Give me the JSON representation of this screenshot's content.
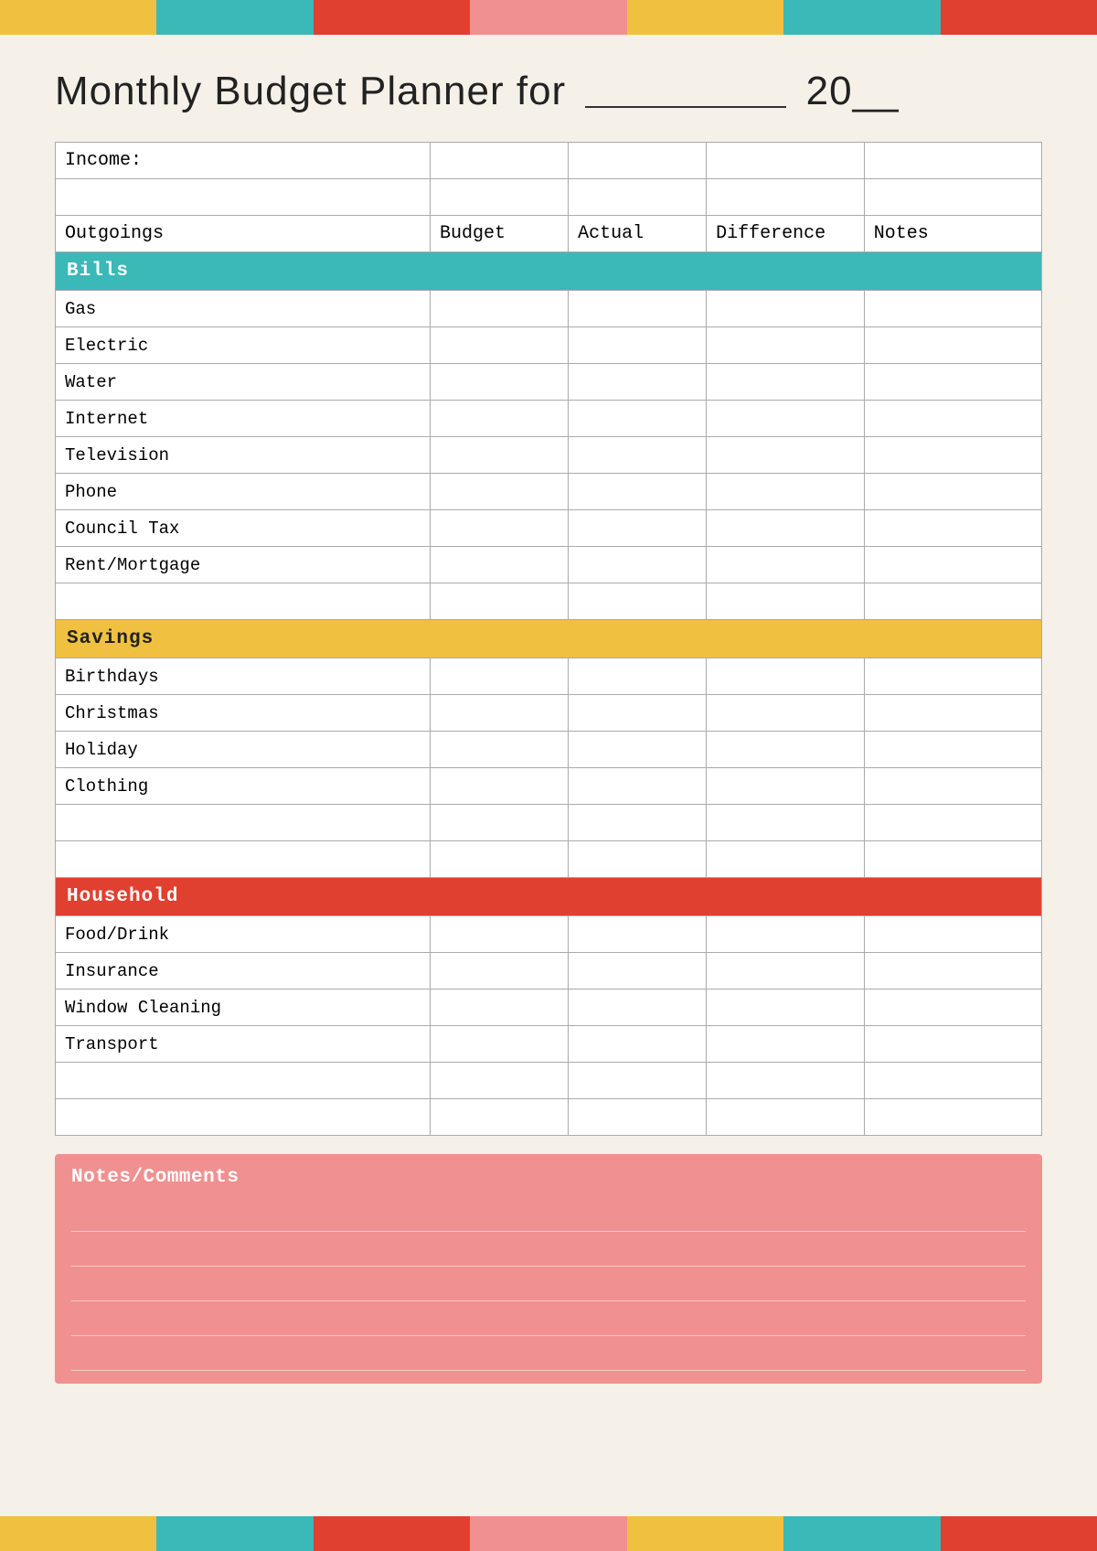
{
  "topBar": {
    "segments": [
      "yellow",
      "teal",
      "red",
      "pink",
      "yellow",
      "teal",
      "red"
    ]
  },
  "title": {
    "part1": "Monthly Budget Planner for",
    "part2": "20"
  },
  "table": {
    "incomeLabel": "Income:",
    "headers": {
      "outgoings": "Outgoings",
      "budget": "Budget",
      "actual": "Actual",
      "difference": "Difference",
      "notes": "Notes"
    },
    "sections": [
      {
        "name": "bills",
        "label": "Bills",
        "color": "bills-header",
        "rows": [
          "Gas",
          "Electric",
          "Water",
          "Internet",
          "Television",
          "Phone",
          "Council Tax",
          "Rent/Mortgage"
        ]
      },
      {
        "name": "savings",
        "label": "Savings",
        "color": "savings-header",
        "rows": [
          "Birthdays",
          "Christmas",
          "Holiday",
          "Clothing"
        ]
      },
      {
        "name": "household",
        "label": "Household",
        "color": "household-header",
        "rows": [
          "Food/Drink",
          "Insurance",
          "Window Cleaning",
          "Transport"
        ]
      }
    ]
  },
  "notes": {
    "title": "Notes/Comments",
    "lineCount": 5
  }
}
